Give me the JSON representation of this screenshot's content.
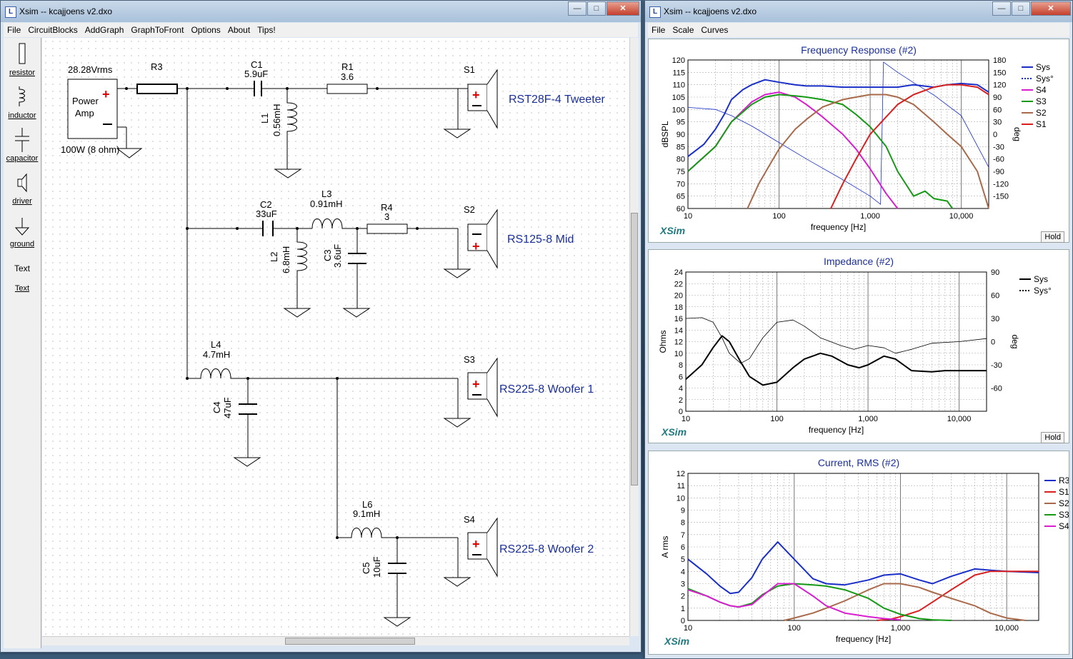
{
  "schematic_window": {
    "title": "Xsim -- kcajjoens v2.dxo",
    "menu": [
      "File",
      "CircuitBlocks",
      "AddGraph",
      "GraphToFront",
      "Options",
      "About",
      "Tips!"
    ],
    "tools": [
      {
        "label": "resistor",
        "icon": "resistor-icon"
      },
      {
        "label": "inductor",
        "icon": "inductor-icon"
      },
      {
        "label": "capacitor",
        "icon": "capacitor-icon"
      },
      {
        "label": "driver",
        "icon": "speaker-icon"
      },
      {
        "label": "ground",
        "icon": "ground-icon"
      },
      {
        "label": "Text",
        "icon": "text-icon"
      },
      {
        "label": "Text",
        "icon": "text-icon"
      }
    ],
    "schematic": {
      "source_voltage": "28.28Vrms",
      "amp_label_1": "Power",
      "amp_label_2": "Amp",
      "amp_rating": "100W (8 ohm)",
      "components": {
        "R3": {
          "name": "R3",
          "value": ""
        },
        "C1": {
          "name": "C1",
          "value": "5.9uF"
        },
        "R1": {
          "name": "R1",
          "value": "3.6"
        },
        "L1": {
          "name": "L1",
          "value": "0.56mH"
        },
        "C2": {
          "name": "C2",
          "value": "33uF"
        },
        "L3": {
          "name": "L3",
          "value": "0.91mH"
        },
        "R4": {
          "name": "R4",
          "value": "3"
        },
        "L2": {
          "name": "L2",
          "value": "6.8mH"
        },
        "C3": {
          "name": "C3",
          "value": "3.6uF"
        },
        "L4": {
          "name": "L4",
          "value": "4.7mH"
        },
        "C4": {
          "name": "C4",
          "value": "47uF"
        },
        "L6": {
          "name": "L6",
          "value": "9.1mH"
        },
        "C5": {
          "name": "C5",
          "value": "10uF"
        }
      },
      "drivers": [
        {
          "id": "S1",
          "label": "RST28F-4 Tweeter"
        },
        {
          "id": "S2",
          "label": "RS125-8 Mid"
        },
        {
          "id": "S3",
          "label": "RS225-8 Woofer 1"
        },
        {
          "id": "S4",
          "label": "RS225-8 Woofer 2"
        }
      ]
    }
  },
  "graph_window": {
    "title": "Xsim -- kcajjoens v2.dxo",
    "menu": [
      "File",
      "Scale",
      "Curves"
    ],
    "brand": "XSim",
    "hold_label": "Hold",
    "x_ticks": [
      "10",
      "100",
      "1,000",
      "10,000"
    ],
    "colors": {
      "sys": "#1a2fc8",
      "s4": "#d81fd0",
      "s3": "#169a16",
      "s2": "#a86a4a",
      "s1": "#d82020",
      "r3": "#1a2fc8",
      "black": "#000000"
    }
  },
  "chart_data": [
    {
      "type": "line",
      "title": "Frequency Response (#2)",
      "xlabel": "frequency [Hz]",
      "ylabel": "dBSPL",
      "y2label": "deg",
      "xscale": "log",
      "xlim": [
        10,
        20000
      ],
      "ylim": [
        60,
        120
      ],
      "y2lim": [
        -180,
        180
      ],
      "yticks": [
        "120",
        "115",
        "110",
        "105",
        "100",
        "95",
        "90",
        "85",
        "80",
        "75",
        "70",
        "65",
        "60"
      ],
      "y2ticks": [
        "180",
        "150",
        "120",
        "90",
        "60",
        "30",
        "0",
        "-30",
        "-60",
        "-90",
        "-120",
        "-150"
      ],
      "grid": true,
      "legend": "right",
      "series": [
        {
          "name": "Sys",
          "axis": "y",
          "color": "#1a2fc8",
          "x": [
            10,
            15,
            20,
            25,
            30,
            40,
            50,
            70,
            100,
            150,
            200,
            300,
            500,
            700,
            1000,
            1500,
            2000,
            3000,
            5000,
            7000,
            10000,
            15000,
            20000
          ],
          "y": [
            81,
            86,
            92,
            98,
            104,
            108,
            110,
            112,
            111,
            110,
            109.5,
            109.5,
            109,
            109,
            109,
            109,
            109,
            110,
            109,
            110,
            110.5,
            110,
            107
          ]
        },
        {
          "name": "Sys°",
          "axis": "y2",
          "color": "#1a2fc8",
          "dash": true,
          "x": [
            10,
            20,
            30,
            50,
            100,
            200,
            500,
            1000,
            1300,
            1400,
            2000,
            3000,
            5000,
            10000,
            20000
          ],
          "y": [
            65,
            60,
            45,
            20,
            -20,
            -60,
            -110,
            -150,
            -170,
            175,
            150,
            125,
            95,
            45,
            -80
          ]
        },
        {
          "name": "S4",
          "axis": "y",
          "color": "#d81fd0",
          "x": [
            10,
            20,
            30,
            50,
            70,
            100,
            150,
            200,
            300,
            500,
            700,
            1000,
            1500,
            2000
          ],
          "y": [
            75,
            85,
            95,
            103,
            106,
            107,
            105,
            102,
            97,
            90,
            84,
            76,
            66,
            60
          ]
        },
        {
          "name": "S3",
          "axis": "y",
          "color": "#169a16",
          "x": [
            10,
            20,
            30,
            50,
            70,
            100,
            150,
            200,
            300,
            500,
            700,
            1000,
            1500,
            2000,
            3000,
            4000,
            5000,
            7000,
            8000
          ],
          "y": [
            75,
            85,
            95,
            102,
            105,
            106,
            105.5,
            105,
            104,
            102,
            98,
            93,
            85,
            75,
            65,
            67,
            64,
            63,
            60
          ]
        },
        {
          "name": "S2",
          "axis": "y",
          "color": "#a86a4a",
          "x": [
            45,
            60,
            80,
            100,
            150,
            200,
            300,
            500,
            700,
            1000,
            1500,
            2000,
            3000,
            5000,
            7000,
            10000,
            15000,
            20000
          ],
          "y": [
            60,
            70,
            78,
            84,
            92,
            96,
            101,
            104,
            105,
            106,
            106,
            105,
            102,
            95,
            90,
            85,
            75,
            60
          ]
        },
        {
          "name": "S1",
          "axis": "y",
          "color": "#d82020",
          "x": [
            370,
            500,
            700,
            1000,
            1500,
            2000,
            3000,
            5000,
            7000,
            10000,
            15000,
            20000
          ],
          "y": [
            60,
            70,
            80,
            90,
            97,
            102,
            106,
            109,
            110,
            110,
            109,
            106
          ]
        }
      ]
    },
    {
      "type": "line",
      "title": "Impedance (#2)",
      "xlabel": "frequency [Hz]",
      "ylabel": "Ohms",
      "y2label": "deg",
      "xscale": "log",
      "xlim": [
        10,
        20000
      ],
      "ylim": [
        0,
        24
      ],
      "y2lim": [
        -90,
        90
      ],
      "yticks": [
        "24",
        "22",
        "20",
        "18",
        "16",
        "14",
        "12",
        "10",
        "8",
        "6",
        "4",
        "2",
        "0"
      ],
      "y2ticks": [
        "90",
        "60",
        "30",
        "0",
        "-30",
        "-60"
      ],
      "grid": true,
      "legend": "right",
      "series": [
        {
          "name": "Sys",
          "axis": "y",
          "color": "#000000",
          "x": [
            10,
            15,
            20,
            25,
            30,
            40,
            50,
            70,
            100,
            150,
            200,
            300,
            400,
            600,
            800,
            1000,
            1500,
            2000,
            3000,
            5000,
            7000,
            10000,
            20000
          ],
          "y": [
            5.5,
            8,
            11,
            13,
            12,
            8.5,
            6,
            4.5,
            5,
            7.5,
            9,
            10,
            9.5,
            8,
            7.5,
            8,
            9.5,
            9,
            7,
            6.8,
            7,
            7,
            7
          ]
        },
        {
          "name": "Sys°",
          "axis": "y2",
          "color": "#000000",
          "dash": true,
          "x": [
            10,
            15,
            20,
            25,
            30,
            40,
            50,
            70,
            100,
            150,
            200,
            300,
            500,
            700,
            1000,
            1500,
            2000,
            3000,
            5000,
            10000,
            20000
          ],
          "y": [
            30,
            31,
            25,
            5,
            -15,
            -28,
            -22,
            5,
            25,
            28,
            20,
            5,
            -5,
            -10,
            -5,
            -8,
            -15,
            -10,
            -2,
            0,
            4
          ]
        }
      ]
    },
    {
      "type": "line",
      "title": "Current, RMS (#2)",
      "xlabel": "frequency [Hz]",
      "ylabel": "A rms",
      "xscale": "log",
      "xlim": [
        10,
        20000
      ],
      "ylim": [
        0,
        12
      ],
      "yticks": [
        "12",
        "11",
        "10",
        "9",
        "8",
        "7",
        "6",
        "5",
        "4",
        "3",
        "2",
        "1",
        "0"
      ],
      "grid": true,
      "legend": "right",
      "series": [
        {
          "name": "R3",
          "color": "#1a2fc8",
          "x": [
            10,
            15,
            20,
            25,
            30,
            40,
            50,
            70,
            100,
            150,
            200,
            300,
            500,
            700,
            1000,
            1500,
            2000,
            3000,
            5000,
            7000,
            10000,
            20000
          ],
          "y": [
            5,
            3.8,
            2.8,
            2.2,
            2.3,
            3.5,
            5,
            6.4,
            5,
            3.4,
            3,
            2.9,
            3.3,
            3.7,
            3.8,
            3.3,
            3,
            3.6,
            4.2,
            4.1,
            4,
            3.9
          ]
        },
        {
          "name": "S1",
          "color": "#d82020",
          "x": [
            600,
            800,
            1000,
            1500,
            2000,
            3000,
            5000,
            7000,
            10000,
            20000
          ],
          "y": [
            0,
            0.1,
            0.3,
            0.8,
            1.5,
            2.5,
            3.7,
            4,
            4,
            4
          ]
        },
        {
          "name": "S2",
          "color": "#a86a4a",
          "x": [
            80,
            100,
            150,
            200,
            300,
            500,
            700,
            1000,
            1500,
            2000,
            3000,
            5000,
            7000,
            10000,
            15000
          ],
          "y": [
            0,
            0.2,
            0.6,
            1,
            1.6,
            2.5,
            3,
            3,
            2.7,
            2.3,
            1.8,
            1.2,
            0.6,
            0.2,
            0
          ]
        },
        {
          "name": "S3",
          "color": "#169a16",
          "x": [
            10,
            15,
            20,
            25,
            30,
            40,
            50,
            70,
            100,
            150,
            200,
            300,
            500,
            700,
            1000,
            1500,
            2000,
            3000
          ],
          "y": [
            2.6,
            2,
            1.5,
            1.2,
            1.1,
            1.4,
            2.1,
            2.8,
            3,
            2.9,
            2.8,
            2.5,
            1.8,
            1,
            0.5,
            0.15,
            0.05,
            0
          ]
        },
        {
          "name": "S4",
          "color": "#d81fd0",
          "x": [
            10,
            15,
            20,
            25,
            30,
            40,
            50,
            70,
            100,
            150,
            200,
            300,
            500,
            700,
            1000
          ],
          "y": [
            2.5,
            2,
            1.5,
            1.2,
            1.1,
            1.3,
            2,
            3,
            3,
            2,
            1.2,
            0.6,
            0.3,
            0.15,
            0.05
          ]
        }
      ]
    }
  ]
}
